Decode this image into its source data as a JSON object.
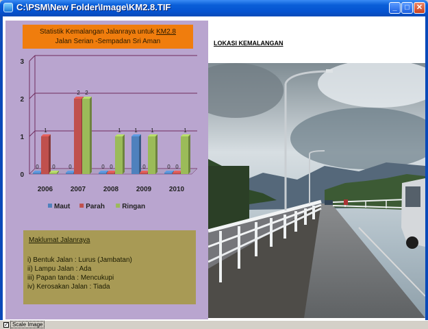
{
  "window": {
    "title": "C:\\PSM\\New Folder\\Image\\KM2.8.TIF",
    "buttons": [
      "_",
      "□",
      "✕"
    ]
  },
  "panel": {
    "title_line1_prefix": "Statistik Kemalangan Jalanraya untuk ",
    "title_line1_km": "KM2.8",
    "title_line2": "Jalan Serian -Sempadan Sri Aman"
  },
  "chart_data": {
    "type": "bar",
    "categories": [
      "2006",
      "2007",
      "2008",
      "2009",
      "2010"
    ],
    "series": [
      {
        "name": "Maut",
        "values": [
          0,
          0,
          0,
          1,
          0
        ],
        "color": "#4f81bd"
      },
      {
        "name": "Parah",
        "values": [
          1,
          2,
          0,
          0,
          0
        ],
        "color": "#c0504d"
      },
      {
        "name": "Ringan",
        "values": [
          0,
          2,
          1,
          1,
          1
        ],
        "color": "#9bbb59"
      }
    ],
    "yticks": [
      "0",
      "1",
      "2",
      "3"
    ],
    "ylim": [
      0,
      3
    ],
    "grid": true,
    "legend": "bottom"
  },
  "info": {
    "title": "Maklumat Jalanraya",
    "lines": [
      "i) Bentuk Jalan  : Lurus (Jambatan)",
      "ii) Lampu Jalan   :  Ada",
      "iii) Papan tanda : Mencukupi",
      "iv) Kerosakan Jalan : Tiada"
    ]
  },
  "location_label": "LOKASI KEMALANGAN",
  "status": {
    "checkbox_checked": true,
    "checkbox_label": "Scale Image"
  }
}
